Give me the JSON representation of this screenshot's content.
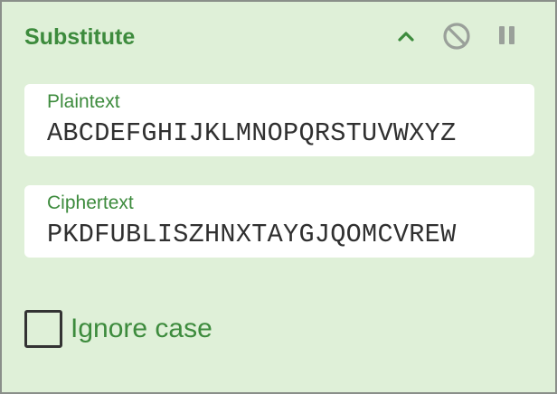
{
  "operation": {
    "title": "Substitute",
    "controls": {
      "collapse_icon": "chevron-up-icon",
      "disable_icon": "disable-icon",
      "pause_icon": "pause-icon"
    },
    "plaintext": {
      "label": "Plaintext",
      "value": "ABCDEFGHIJKLMNOPQRSTUVWXYZ"
    },
    "ciphertext": {
      "label": "Ciphertext",
      "value": "PKDFUBLISZHNXTAYGJQOMCVREW"
    },
    "ignore_case": {
      "label": "Ignore case",
      "checked": false
    }
  },
  "colors": {
    "panel_background": "#dff0d8",
    "accent": "#3d8b3d",
    "icon": "#9aa09a"
  }
}
